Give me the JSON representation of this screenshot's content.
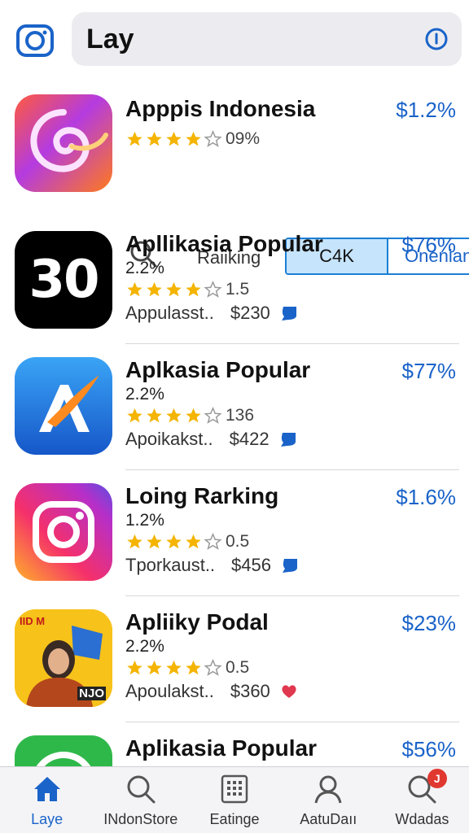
{
  "header": {
    "search_value": "Lay",
    "camera_icon": "camera-icon",
    "info_icon": "info-icon"
  },
  "first_row_controls": {
    "search_icon": "search-icon",
    "label": "Raiiking",
    "segment_selected": "C4K",
    "segment_other": "Onenian"
  },
  "apps": [
    {
      "name": "Apppis Indonesia",
      "price": "$1.2%",
      "sub": "",
      "rating": "09%",
      "stars": 4,
      "meta_left": "",
      "meta_price": "",
      "icon": "swirl-app-icon"
    },
    {
      "name": "Apllikasia Popular",
      "price": "$76%",
      "sub": "2.2%",
      "rating": "1.5",
      "stars": 4,
      "meta_left": "Appulasst..",
      "meta_price": "$230",
      "icon": "30-app-icon",
      "icon_text": "30"
    },
    {
      "name": "Aplkasia Popular",
      "price": "$77%",
      "sub": "2.2%",
      "rating": "136",
      "stars": 4,
      "meta_left": "Apoikakst..",
      "meta_price": "$422",
      "icon": "brush-app-icon"
    },
    {
      "name": "Loing Rarking",
      "price": "$1.6%",
      "sub": "1.2%",
      "rating": "0.5",
      "stars": 4,
      "meta_left": "Tporkaust..",
      "meta_price": "$456",
      "icon": "instagram-app-icon"
    },
    {
      "name": "Apliiky Podal",
      "price": "$23%",
      "sub": "2.2%",
      "rating": "0.5",
      "stars": 4,
      "meta_left": "Apoulakst..",
      "meta_price": "$360",
      "icon": "portrait-app-icon",
      "icon_text_a": "IID M",
      "icon_text_b": "NJO"
    },
    {
      "name": "Aplikasia Popular",
      "price": "$56%",
      "icon": "green-app-icon"
    }
  ],
  "tabs": [
    {
      "label": "Laye",
      "icon": "home-icon",
      "active": true
    },
    {
      "label": "INdonStore",
      "icon": "search-icon",
      "active": false
    },
    {
      "label": "Eatinge",
      "icon": "grid-icon",
      "active": false
    },
    {
      "label": "AatuDaıı",
      "icon": "person-icon",
      "active": false
    },
    {
      "label": "Wdadas",
      "icon": "search-badge-icon",
      "active": false,
      "badge": "J"
    }
  ],
  "colors": {
    "accent": "#1a63c9",
    "star": "#f4b400",
    "badge": "#e0382f"
  }
}
